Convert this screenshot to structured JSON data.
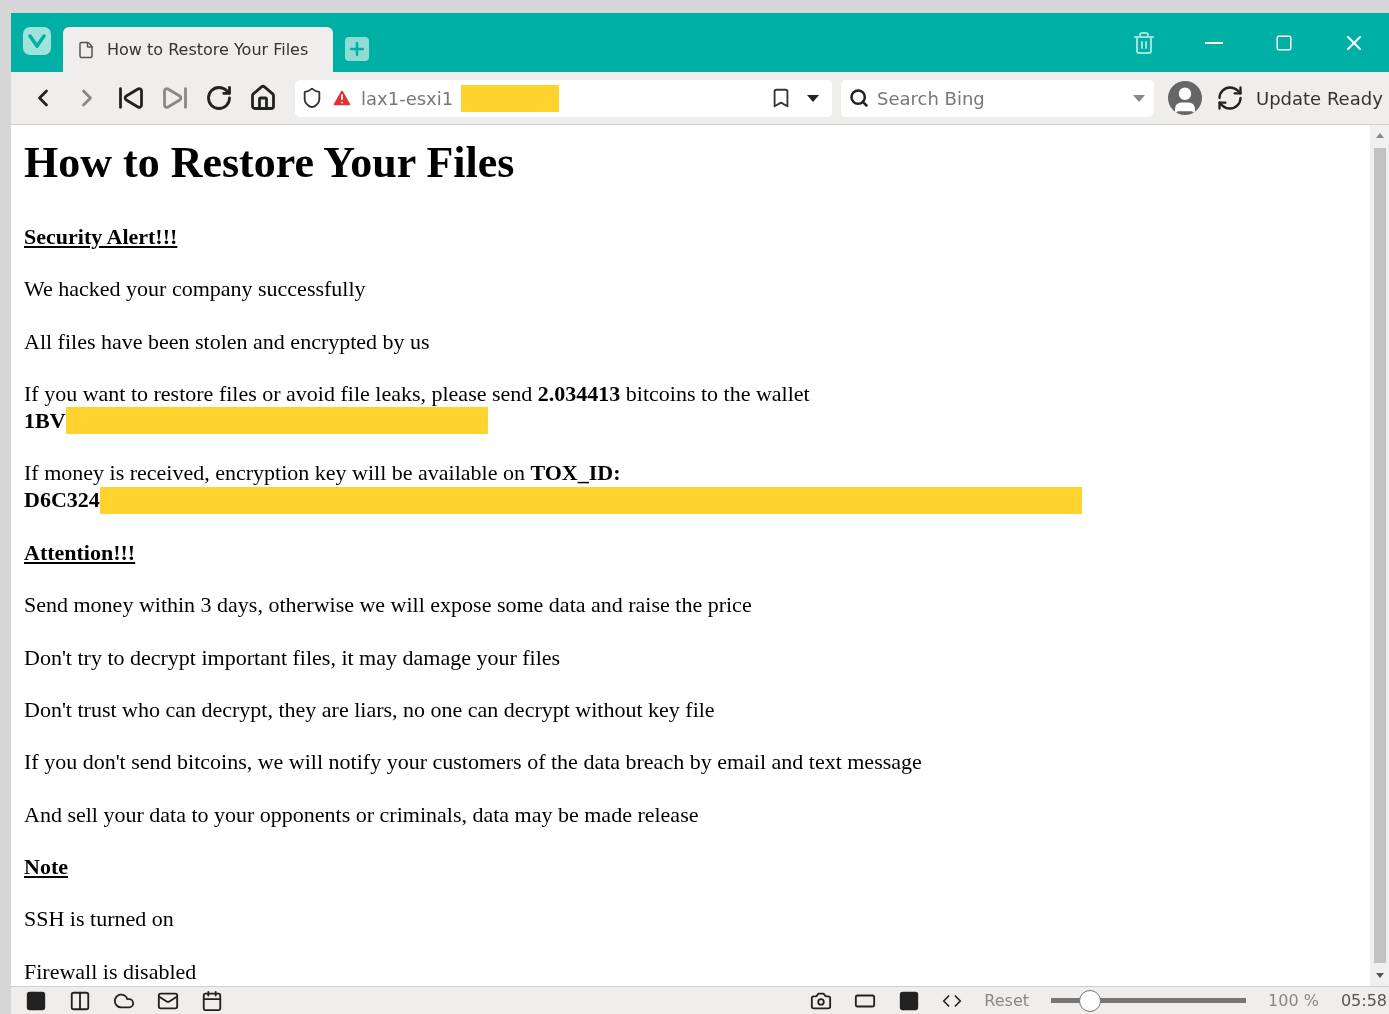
{
  "tabs": [
    {
      "title": "How to Restore Your Files",
      "selected": true
    }
  ],
  "nav": [
    {
      "kind": "back",
      "disabled": false
    },
    {
      "kind": "forward",
      "disabled": true
    },
    {
      "kind": "first",
      "disabled": false
    },
    {
      "kind": "last",
      "disabled": true
    },
    {
      "kind": "reload",
      "disabled": false
    },
    {
      "kind": "home",
      "disabled": false
    }
  ],
  "address": {
    "text": "lax1-esxi1",
    "redacted": true
  },
  "search": {
    "placeholder": "Search Bing"
  },
  "update": {
    "label": "Update Ready"
  },
  "page": {
    "title": "How to Restore Your Files",
    "blocks": [
      {
        "kind": "heading",
        "text": "Security Alert!!!"
      },
      {
        "kind": "text",
        "text": "We hacked your company successfully"
      },
      {
        "kind": "text",
        "text": "All files have been stolen and encrypted by us"
      },
      {
        "kind": "wallet",
        "text": "If you want to restore files or avoid file leaks, please send **2.034413** bitcoins to the wallet",
        "value": "1BV",
        "redacted": true
      },
      {
        "kind": "key",
        "text": "If money is received, encryption key will be available on **TOX_ID:**",
        "value": "D6C324",
        "redacted": true
      },
      {
        "kind": "heading",
        "text": "Attention!!!"
      },
      {
        "kind": "text",
        "text": "Send money within 3 days, otherwise we will expose some data and raise the price"
      },
      {
        "kind": "text",
        "text": "Don't try to decrypt important files, it may damage your files"
      },
      {
        "kind": "text",
        "text": "Don't trust who can decrypt, they are liars, no one can decrypt without key file"
      },
      {
        "kind": "text",
        "text": "If you don't send bitcoins, we will notify your customers of the data breach by email and text message"
      },
      {
        "kind": "text",
        "text": "And sell your data to your opponents or criminals, data may be made release"
      },
      {
        "kind": "heading",
        "text": "Note"
      },
      {
        "kind": "text",
        "text": "SSH is turned on"
      },
      {
        "kind": "text",
        "text": "Firewall is disabled"
      }
    ]
  },
  "status_bar": {
    "reset": "Reset",
    "zoom": {
      "level": 0.2
    },
    "zoom_text": "100 %",
    "time": "05:58"
  }
}
